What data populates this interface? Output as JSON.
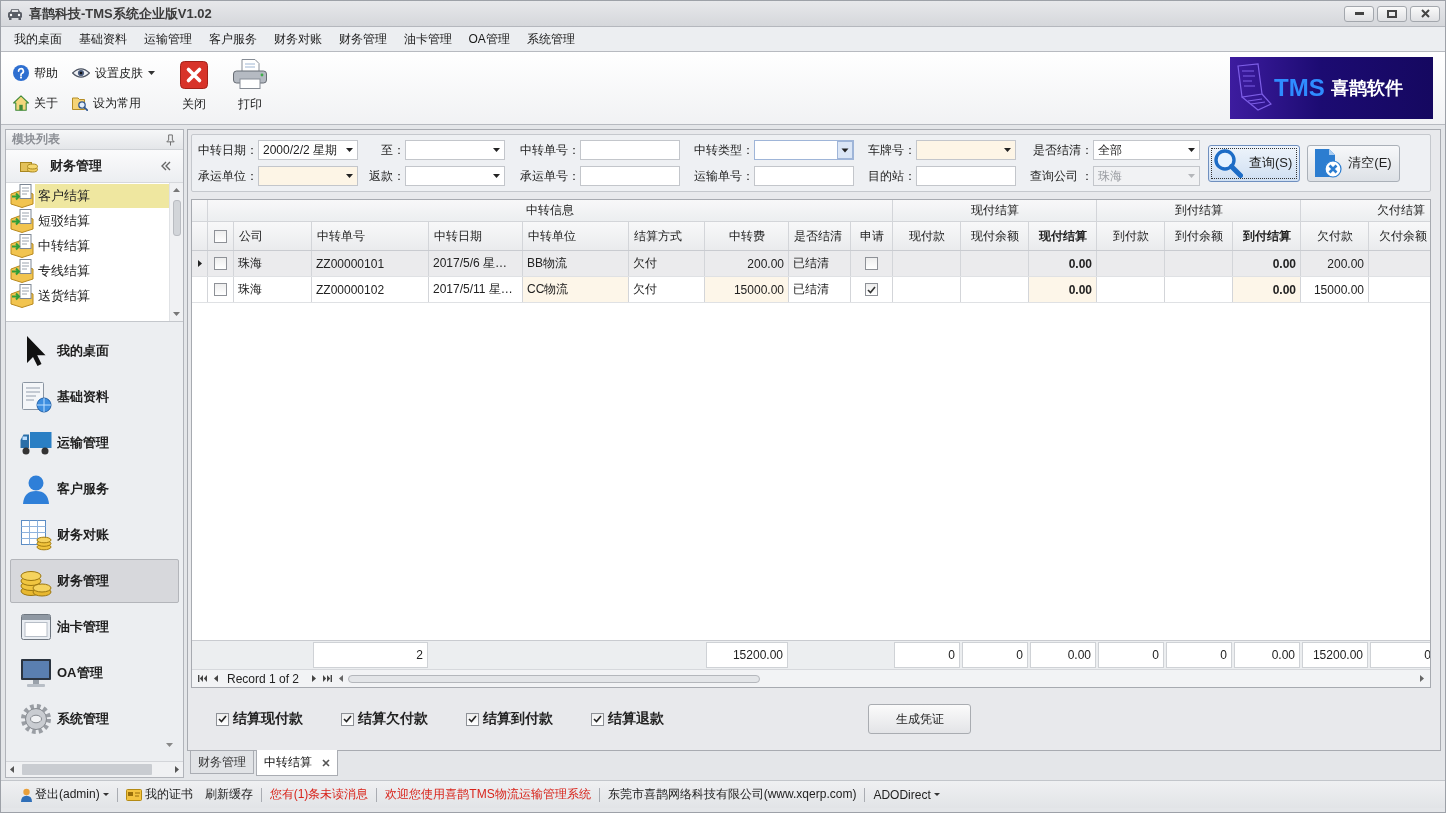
{
  "window": {
    "title": "喜鹊科技-TMS系统企业版V1.02"
  },
  "menu": [
    "我的桌面",
    "基础资料",
    "运输管理",
    "客户服务",
    "财务对账",
    "财务管理",
    "油卡管理",
    "OA管理",
    "系统管理"
  ],
  "toolbar": {
    "small_buttons": [
      {
        "label": "帮助",
        "dropdown": false
      },
      {
        "label": "设置皮肤",
        "dropdown": true
      },
      {
        "label": "关于",
        "dropdown": false
      },
      {
        "label": "设为常用",
        "dropdown": false
      }
    ],
    "large_buttons": [
      "关闭",
      "打印"
    ]
  },
  "logo": {
    "brand": "TMS",
    "name": "喜鹊软件"
  },
  "sidebar": {
    "title": "模块列表",
    "group": {
      "title": "财务管理",
      "items": [
        {
          "label": "客户结算",
          "selected": true
        },
        {
          "label": "短驳结算",
          "selected": false
        },
        {
          "label": "中转结算",
          "selected": false
        },
        {
          "label": "专线结算",
          "selected": false
        },
        {
          "label": "送货结算",
          "selected": false
        }
      ]
    },
    "nav": [
      {
        "label": "我的桌面",
        "selected": false
      },
      {
        "label": "基础资料",
        "selected": false
      },
      {
        "label": "运输管理",
        "selected": false
      },
      {
        "label": "客户服务",
        "selected": false
      },
      {
        "label": "财务对账",
        "selected": false
      },
      {
        "label": "财务管理",
        "selected": true
      },
      {
        "label": "油卡管理",
        "selected": false
      },
      {
        "label": "OA管理",
        "selected": false
      },
      {
        "label": "系统管理",
        "selected": false
      }
    ]
  },
  "filters": {
    "rows": [
      [
        {
          "label": "中转日期：",
          "kind": "dropdown",
          "value": "2000/2/2 星期",
          "highlighted": false,
          "focused": false,
          "disabled": false
        },
        {
          "label": "至：",
          "kind": "dropdown",
          "highlighted": false,
          "focused": false,
          "disabled": false
        },
        {
          "label": "中转单号：",
          "kind": "text",
          "highlighted": false,
          "focused": false,
          "disabled": false
        },
        {
          "label": "中转类型：",
          "kind": "dropdown",
          "highlighted": false,
          "focused": true,
          "disabled": false
        },
        {
          "label": "车牌号：",
          "kind": "dropdown",
          "highlighted": true,
          "focused": false,
          "disabled": false
        },
        {
          "label": "是否结清：",
          "kind": "dropdown",
          "value": "全部",
          "highlighted": false,
          "focused": false,
          "disabled": false
        }
      ],
      [
        {
          "label": "承运单位：",
          "kind": "dropdown",
          "highlighted": true,
          "focused": false,
          "disabled": false
        },
        {
          "label": "返款：",
          "kind": "dropdown",
          "highlighted": false,
          "focused": false,
          "disabled": false
        },
        {
          "label": "承运单号：",
          "kind": "text",
          "highlighted": false,
          "focused": false,
          "disabled": false
        },
        {
          "label": "运输单号：",
          "kind": "text",
          "highlighted": false,
          "focused": false,
          "disabled": false
        },
        {
          "label": "目的站：",
          "kind": "text",
          "highlighted": false,
          "focused": false,
          "disabled": false
        },
        {
          "label": "查询公司 ：",
          "kind": "dropdown",
          "value": "珠海",
          "highlighted": false,
          "focused": false,
          "disabled": true
        }
      ]
    ],
    "buttons": [
      {
        "label": "查询(S)",
        "focused": true
      },
      {
        "label": "清空(E)",
        "focused": false
      }
    ]
  },
  "grid": {
    "bands": [
      {
        "label": "中转信息",
        "columns": [
          {
            "kind": "check",
            "checked": false
          },
          {
            "label": "公司",
            "kind": "text",
            "editable": false
          },
          {
            "label": "中转单号",
            "kind": "text",
            "editable": false,
            "total": "2"
          },
          {
            "label": "中转日期",
            "kind": "text",
            "editable": false
          },
          {
            "label": "中转单位",
            "kind": "text",
            "editable": true
          },
          {
            "label": "结算方式",
            "kind": "text",
            "editable": false
          },
          {
            "label": "中转费",
            "kind": "amount",
            "editable": true,
            "total": "15200.00"
          },
          {
            "label": "是否结清",
            "kind": "text",
            "editable": false
          },
          {
            "label": "申请",
            "kind": "check"
          }
        ]
      },
      {
        "label": "现付结算",
        "columns": [
          {
            "label": "现付款",
            "kind": "amount",
            "total": "0"
          },
          {
            "label": "现付余额",
            "kind": "amount",
            "total": "0"
          },
          {
            "label": "现付结算",
            "kind": "total",
            "editable": true,
            "total": "0.00"
          }
        ]
      },
      {
        "label": "到付结算",
        "columns": [
          {
            "label": "到付款",
            "kind": "amount",
            "total": "0"
          },
          {
            "label": "到付余额",
            "kind": "amount",
            "total": "0"
          },
          {
            "label": "到付结算",
            "kind": "total",
            "editable": true,
            "total": "0.00"
          }
        ]
      },
      {
        "label": "欠付结算",
        "columns": [
          {
            "label": "欠付款",
            "kind": "amount",
            "editable": false,
            "total": "15200.00"
          },
          {
            "label": "欠付余额",
            "kind": "amount",
            "total": "0"
          }
        ]
      }
    ],
    "rows": [
      {
        "current": true,
        "cells": [
          false,
          "珠海",
          "ZZ00000101",
          "2017/5/6 星…",
          "BB物流",
          "欠付",
          "200.00",
          "已结清",
          false,
          null,
          null,
          "0.00",
          null,
          null,
          "0.00",
          "200.00",
          null
        ]
      },
      {
        "current": false,
        "cells": [
          false,
          "珠海",
          "ZZ00000102",
          "2017/5/11 星…",
          "CC物流",
          "欠付",
          "15000.00",
          "已结清",
          true,
          null,
          null,
          "0.00",
          null,
          null,
          "0.00",
          "15000.00",
          null
        ]
      }
    ],
    "navigator": {
      "record": "Record 1 of 2"
    }
  },
  "settle_options": [
    {
      "label": "结算现付款",
      "checked": true
    },
    {
      "label": "结算欠付款",
      "checked": true
    },
    {
      "label": "结算到付款",
      "checked": true
    },
    {
      "label": "结算退款",
      "checked": true
    }
  ],
  "generate_button": "生成凭证",
  "tabs": [
    {
      "label": "财务管理",
      "selected": false,
      "closable": false
    },
    {
      "label": "中转结算",
      "selected": true,
      "closable": true
    }
  ],
  "status_bar": [
    [
      {
        "label": "登出(admin)",
        "kind": "account",
        "dropdown": true
      }
    ],
    [
      {
        "label": "我的证书",
        "kind": "certificate",
        "dropdown": false
      },
      {
        "label": "刷新缓存",
        "kind": "link",
        "dropdown": false
      }
    ],
    [
      {
        "label": "您有(1)条未读消息",
        "kind": "alert",
        "dropdown": false
      }
    ],
    [
      {
        "label": "欢迎您使用喜鹊TMS物流运输管理系统",
        "kind": "alert",
        "dropdown": false
      }
    ],
    [
      {
        "label": "东莞市喜鹊网络科技有限公司(www.xqerp.com)",
        "kind": "text",
        "dropdown": false
      }
    ],
    [
      {
        "label": "ADODirect",
        "kind": "menu",
        "dropdown": true
      }
    ]
  ]
}
